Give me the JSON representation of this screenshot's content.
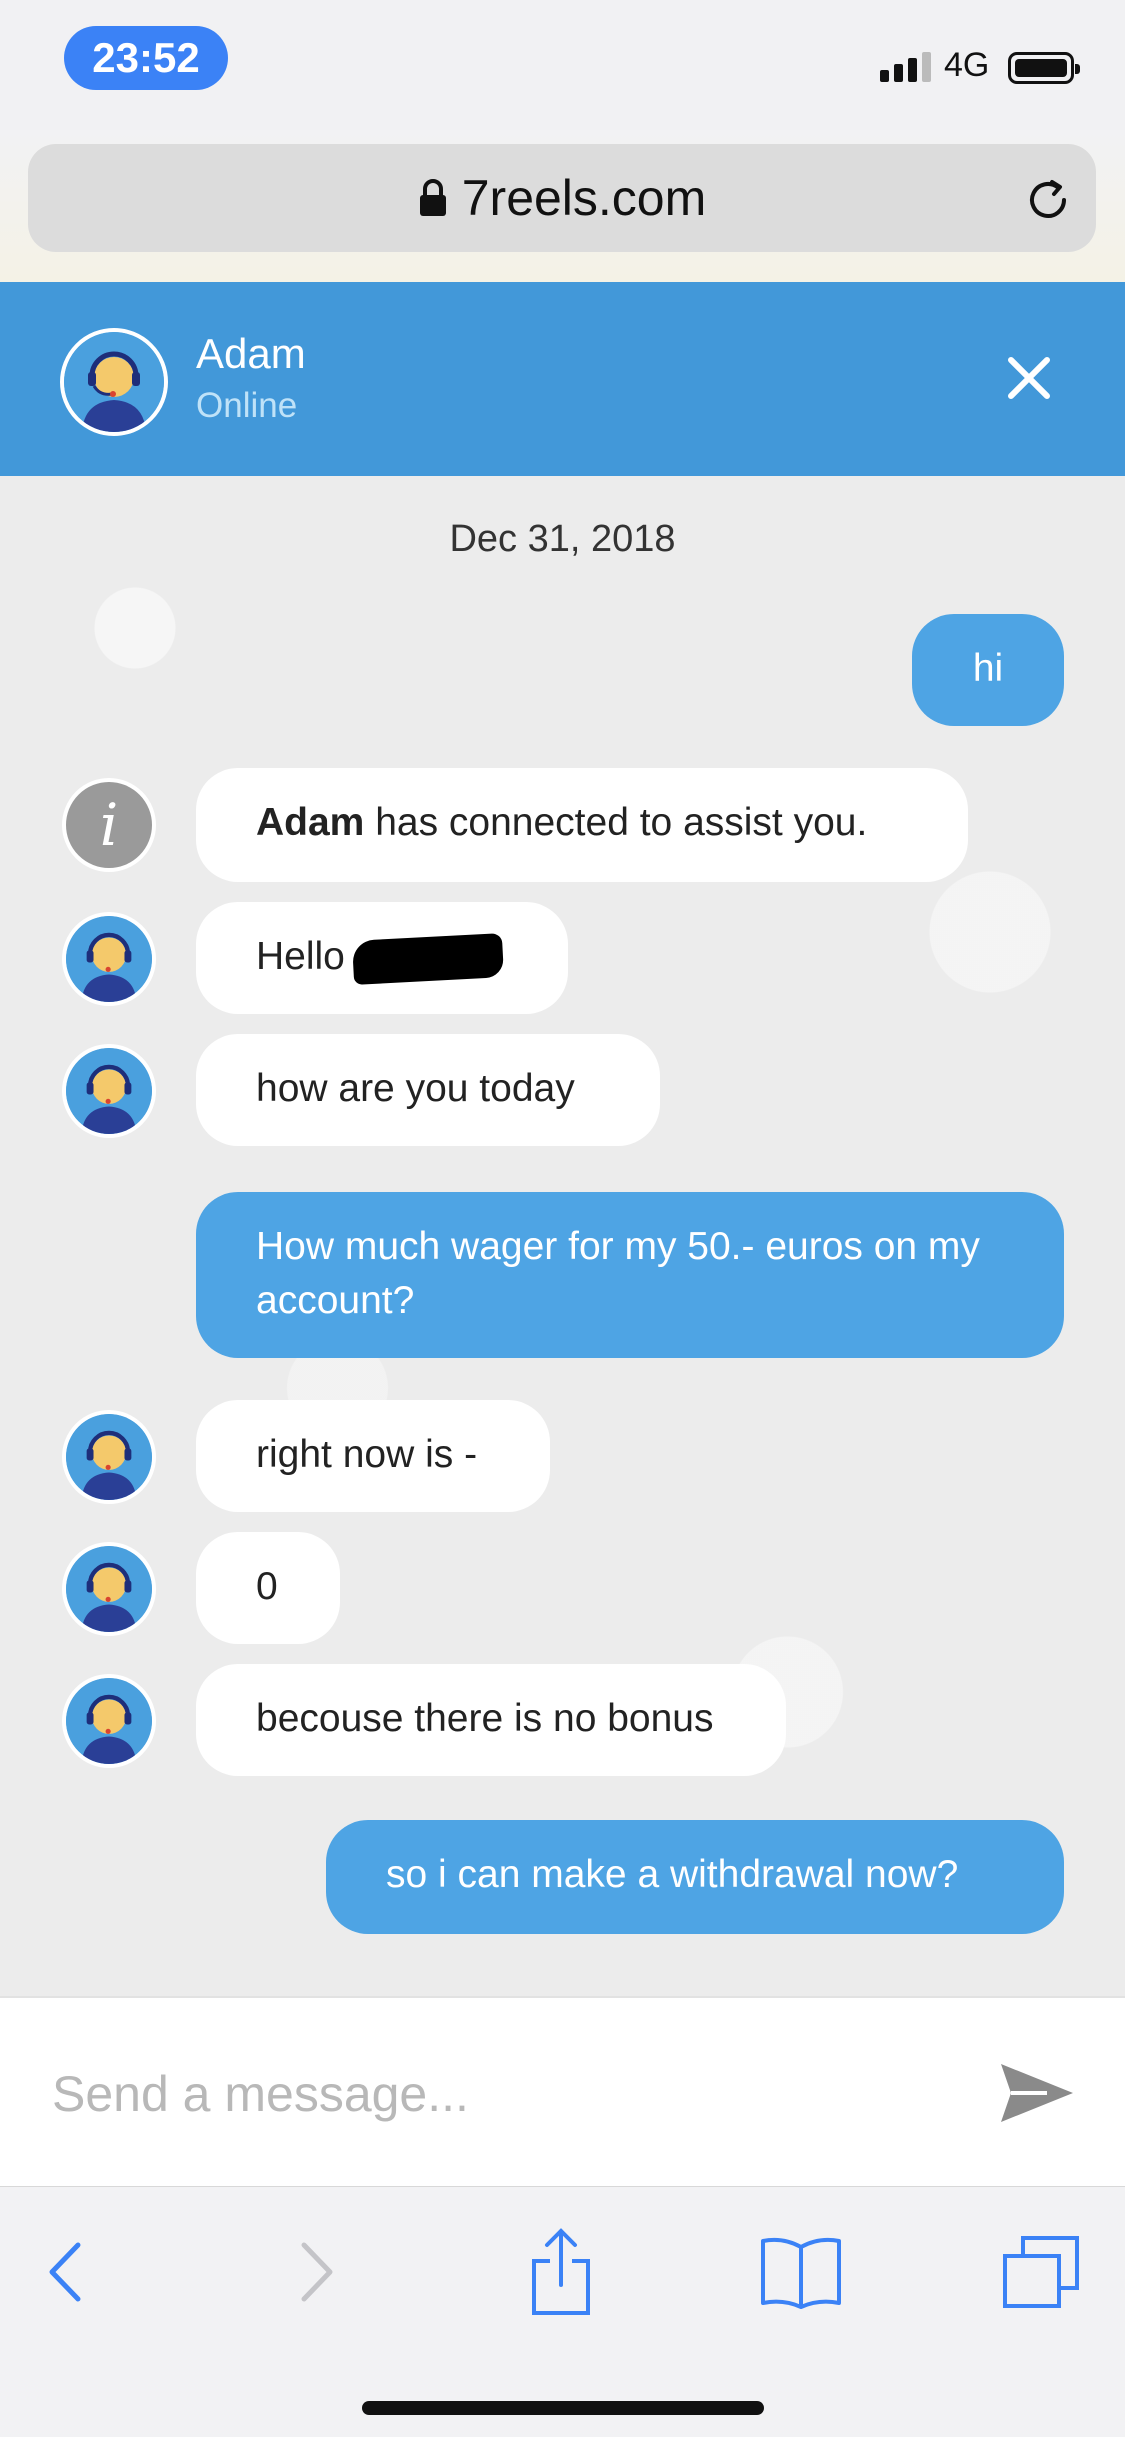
{
  "status_bar": {
    "time": "23:52",
    "network": "4G"
  },
  "browser": {
    "url": "7reels.com"
  },
  "chat_header": {
    "agent_name": "Adam",
    "agent_status": "Online"
  },
  "chat": {
    "date": "Dec 31, 2018",
    "messages": [
      {
        "from": "user",
        "text": "hi"
      },
      {
        "from": "system",
        "bold": "Adam",
        "text": " has connected to assist you."
      },
      {
        "from": "agent",
        "text": "Hello"
      },
      {
        "from": "agent",
        "text": "how are you today"
      },
      {
        "from": "user",
        "text": "How much wager for my 50.- euros on my account?"
      },
      {
        "from": "agent",
        "text": "right now is -"
      },
      {
        "from": "agent",
        "text": "0"
      },
      {
        "from": "agent",
        "text": "becouse there is no bonus"
      },
      {
        "from": "user",
        "text": "so i can make a withdrawal now?"
      }
    ]
  },
  "composer": {
    "placeholder": "Send a message..."
  },
  "icons": {
    "lock": "lock-icon",
    "reload": "reload-icon",
    "close": "close-icon",
    "send": "send-icon",
    "back": "back-icon",
    "forward": "forward-icon",
    "share": "share-icon",
    "bookmarks": "bookmarks-icon",
    "tabs": "tabs-icon",
    "info": "info-icon"
  },
  "colors": {
    "accent": "#4298d9",
    "user_bubble": "#4ea4e4",
    "time_pill": "#3b82f6",
    "toolbar_icon": "#3b82f6"
  }
}
